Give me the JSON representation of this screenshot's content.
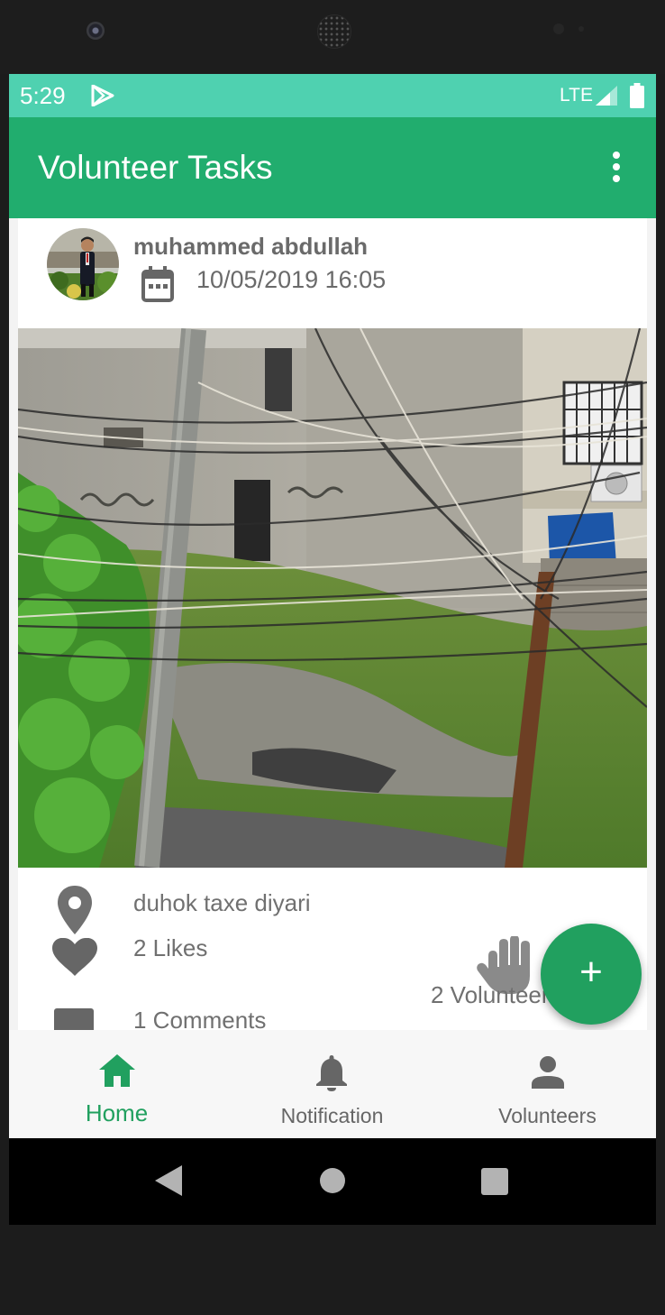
{
  "status_bar": {
    "time": "5:29",
    "network": "LTE",
    "icons": [
      "play-store-icon",
      "signal-icon",
      "battery-icon"
    ]
  },
  "app_bar": {
    "title": "Volunteer Tasks",
    "menu_icon": "overflow-menu-icon"
  },
  "post": {
    "author": "muhammed abdullah",
    "date": "10/05/2019 16:05",
    "location": "duhok taxe diyari",
    "likes": "2 Likes",
    "comments": "1 Comments",
    "volunteers": "2 Volunteers"
  },
  "fab": {
    "label": "+"
  },
  "bottom_nav": {
    "items": [
      {
        "label": "Home",
        "icon": "home-icon",
        "active": true
      },
      {
        "label": "Notification",
        "icon": "bell-icon",
        "active": false
      },
      {
        "label": "Volunteers",
        "icon": "person-icon",
        "active": false
      }
    ]
  },
  "colors": {
    "status_bar": "#4fd1b0",
    "app_bar": "#21ad6e",
    "accent": "#21a05f",
    "text_secondary": "#6a6a6a"
  }
}
